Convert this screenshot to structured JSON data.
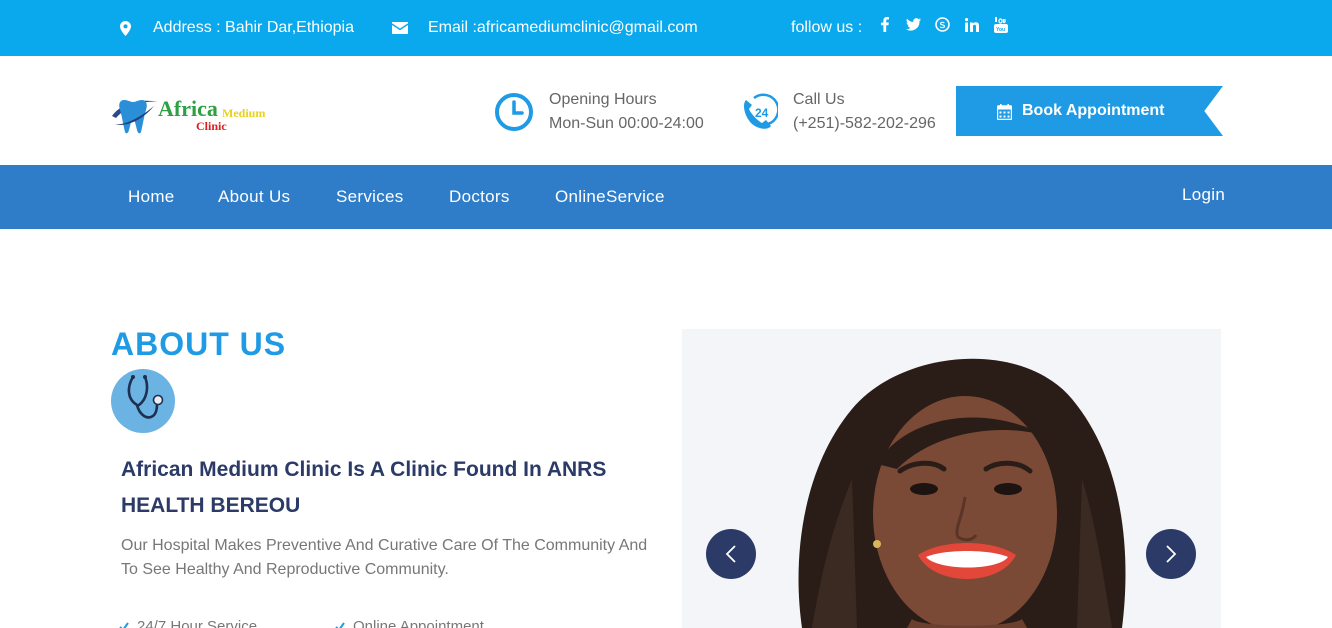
{
  "topbar": {
    "address": "Address : Bahir Dar,Ethiopia",
    "email": "Email :africamediumclinic@gmail.com",
    "follow": "follow us :",
    "social": [
      "facebook-icon",
      "twitter-icon",
      "skype-icon",
      "linkedin-icon",
      "youtube-icon"
    ]
  },
  "logo": {
    "africa": "Africa",
    "medium": "Medium",
    "clinic": "Clinic"
  },
  "header": {
    "hours_label": "Opening Hours",
    "hours_value": "Mon-Sun 00:00-24:00",
    "call_label": "Call Us",
    "call_value": "(+251)-582-202-296",
    "book_label": "Book Appointment"
  },
  "nav": {
    "items": [
      "Home",
      "About Us",
      "Services",
      "Doctors",
      "OnlineService"
    ],
    "login": "Login"
  },
  "about": {
    "title": "ABOUT US",
    "headline": "African Medium Clinic Is A Clinic Found In ANRS HEALTH BEREOU",
    "paragraph": "Our Hospital Makes Preventive And Curative Care Of The Community And To See Healthy And Reproductive Community.",
    "features": [
      "24/7 Hour Service",
      "Online Appointment"
    ]
  },
  "colors": {
    "topbar": "#0aa8ec",
    "nav": "#2f7dc8",
    "accent": "#1e9be4",
    "heading": "#2b3a67"
  }
}
